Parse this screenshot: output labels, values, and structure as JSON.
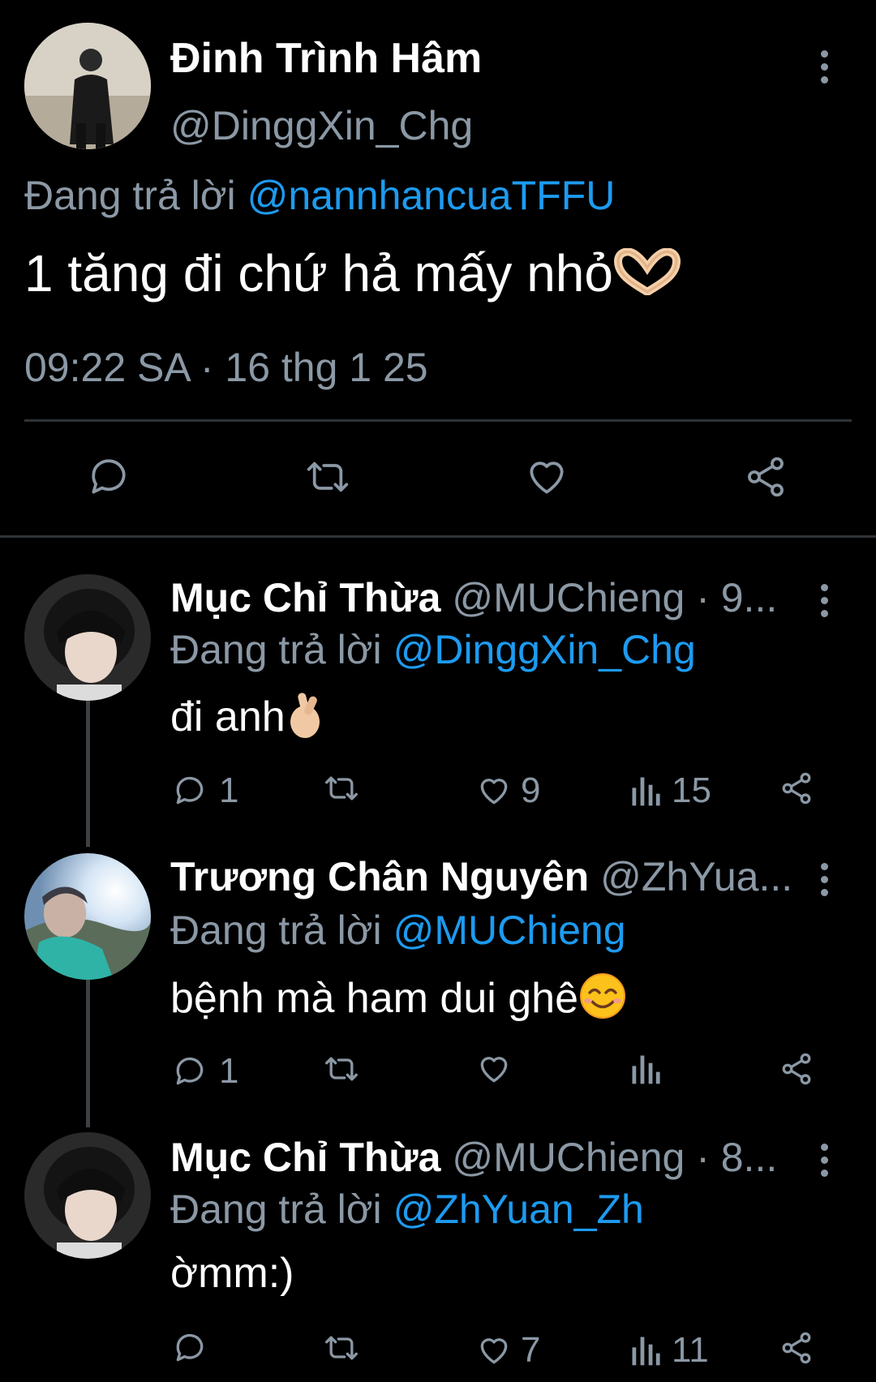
{
  "main_tweet": {
    "author_name": "Đinh Trình Hâm",
    "author_handle": "@DinggXin_Chg",
    "replying_prefix": "Đang trả lời",
    "replying_to": "@nannhancuaTFFU",
    "text": "1 tăng đi chứ hả mấy nhỏ",
    "emoji": "heart-hands",
    "timestamp": "09:22 SA · 16 thg 1 25",
    "actions": [
      "reply-icon",
      "retweet-icon",
      "like-icon",
      "share-icon"
    ]
  },
  "replies": [
    {
      "author_name": "Mục Chỉ Thừa",
      "author_handle": "@MUChieng · 9...",
      "replying_prefix": "Đang trả lời",
      "replying_to": "@DinggXin_Chg",
      "text": "đi anh",
      "emoji": "finger-heart",
      "reply_count": "1",
      "retweet_count": "",
      "like_count": "9",
      "view_count": "15"
    },
    {
      "author_name": "Trương Chân Nguyên",
      "author_handle": "@ZhYua...",
      "replying_prefix": "Đang trả lời",
      "replying_to": "@MUChieng",
      "text": "bệnh mà ham dui ghê",
      "emoji": "smiling-face",
      "reply_count": "1",
      "retweet_count": "",
      "like_count": "",
      "view_count": ""
    },
    {
      "author_name": "Mục Chỉ Thừa",
      "author_handle": "@MUChieng · 8...",
      "replying_prefix": "Đang trả lời",
      "replying_to": "@ZhYuan_Zh",
      "text": "ờmm:)",
      "emoji": "",
      "reply_count": "",
      "retweet_count": "",
      "like_count": "7",
      "view_count": "11"
    }
  ],
  "colors": {
    "background": "#000000",
    "secondary_text": "#8b98a5",
    "link": "#1d9bf0",
    "divider": "#2f3336"
  }
}
